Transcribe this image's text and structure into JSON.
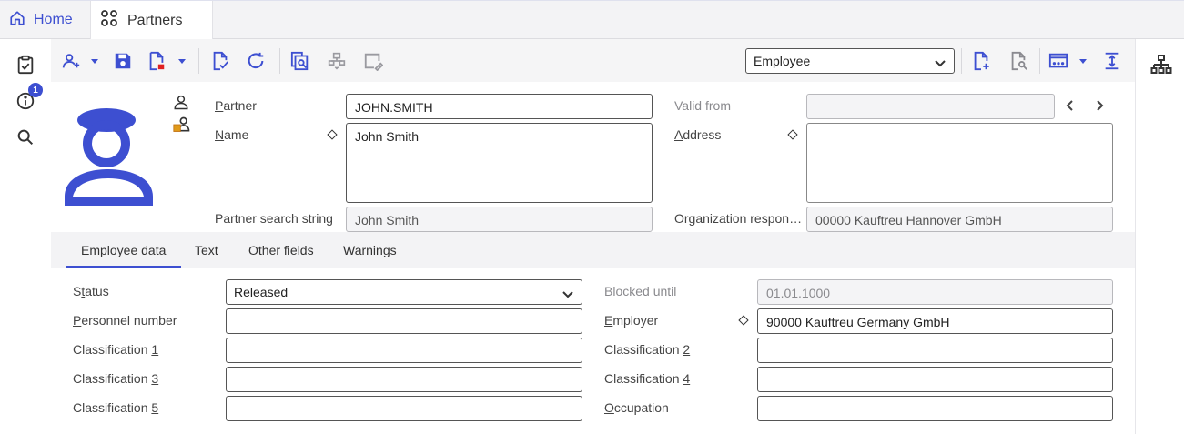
{
  "tabs": {
    "home_label": "Home",
    "partners_label": "Partners"
  },
  "sidebar": {
    "info_badge": "1"
  },
  "toolbar": {
    "view_select_value": "Employee"
  },
  "header": {
    "partner_label": "Partner",
    "partner_value": "JOHN.SMITH",
    "name_label": "Name",
    "name_value": "John Smith",
    "search_string_label": "Partner search string",
    "search_string_value": "John Smith",
    "valid_from_label": "Valid from",
    "valid_from_value": "",
    "address_label": "Address",
    "address_value": "",
    "org_label": "Organization respon…",
    "org_value": "00000 Kauftreu Hannover GmbH"
  },
  "subtabs": [
    {
      "label": "Employee data"
    },
    {
      "label": "Text"
    },
    {
      "label": "Other fields"
    },
    {
      "label": "Warnings"
    }
  ],
  "employee": {
    "status_label": "Status",
    "status_value": "Released",
    "personnel_label": "Personnel number",
    "personnel_value": "",
    "class1_label": "Classification 1",
    "class1_value": "",
    "class3_label": "Classification 3",
    "class3_value": "",
    "class5_label": "Classification 5",
    "class5_value": "",
    "blocked_label": "Blocked until",
    "blocked_value": "01.01.1000",
    "employer_label": "Employer",
    "employer_value": "90000 Kauftreu Germany GmbH",
    "class2_label": "Classification 2",
    "class2_value": "",
    "class4_label": "Classification 4",
    "class4_value": "",
    "occupation_label": "Occupation",
    "occupation_value": ""
  },
  "colors": {
    "accent": "#3d4fd1",
    "toolbar_bg": "#f5f5f6",
    "readonly_bg": "#f4f4f6"
  }
}
